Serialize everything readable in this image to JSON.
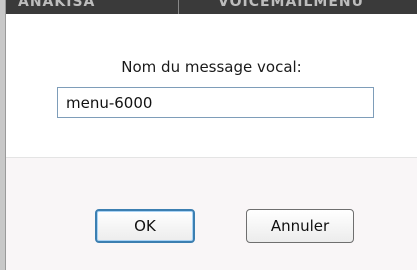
{
  "background": {
    "ghost_text_left": "ANAKISA",
    "ghost_text_right": "VOICEMAILMENU"
  },
  "dialog": {
    "prompt_label": "Nom du message vocal:",
    "name_input": {
      "value": "menu-6000",
      "placeholder": ""
    },
    "buttons": {
      "ok_label": "OK",
      "cancel_label": "Annuler"
    }
  },
  "colors": {
    "focus_border": "#3c7fb1",
    "input_border": "#7e9db9",
    "footer_bg": "#f9f6f7"
  }
}
